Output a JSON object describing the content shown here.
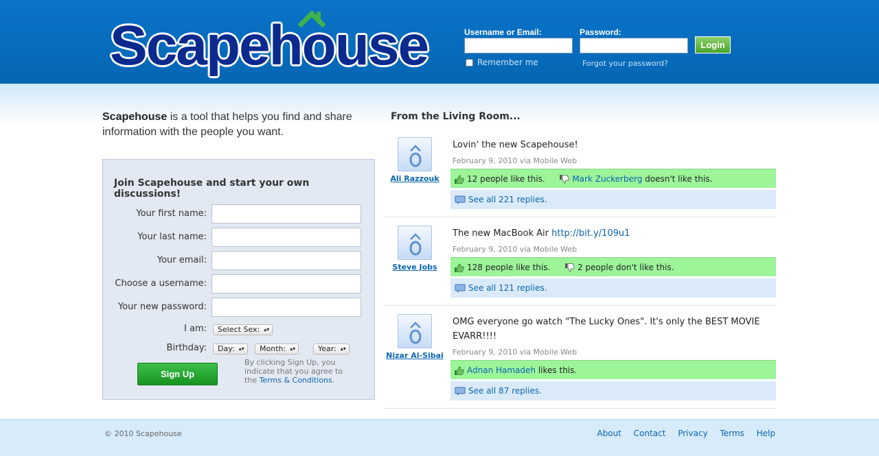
{
  "header": {
    "logo_text": "Scapehouse",
    "login": {
      "username_label": "Username or Email:",
      "password_label": "Password:",
      "login_button": "Login",
      "remember_label": "Remember me",
      "forgot_link": "Forgot your password?"
    }
  },
  "intro": {
    "brand": "Scapehouse",
    "text": " is a tool that helps you find and share information with the people you want."
  },
  "signup": {
    "title": "Join Scapehouse and start your own discussions!",
    "fields": {
      "first_name": "Your first name:",
      "last_name": "Your last name:",
      "email": "Your email:",
      "username": "Choose a username:",
      "password": "Your new password:",
      "iam": "I am:",
      "birthday": "Birthday:"
    },
    "sex_select": "Select Sex:",
    "day_select": "Day:",
    "month_select": "Month:",
    "year_select": "Year:",
    "signup_button": "Sign Up",
    "terms_text": "By clicking Sign Up, you indicate that you agree to the ",
    "terms_link": "Terms & Conditions",
    "terms_end": "."
  },
  "feed": {
    "title": "From the Living Room...",
    "posts": [
      {
        "author": "Ali Razzouk",
        "text": "Lovin' the new Scapehouse!",
        "meta": "February 9, 2010 via Mobile Web",
        "likes_text": "12 people like this.",
        "dislike_user": "Mark Zuckerberg",
        "dislike_text": " doesn't like this.",
        "replies": "See all 221 replies."
      },
      {
        "author": "Steve Jobs",
        "text": "The new MacBook Air ",
        "link": "http://bit.y/109u1",
        "meta": "February 9, 2010 via Mobile Web",
        "likes_text": "128 people like this.",
        "dislike_text": "2 people don't like this.",
        "replies": "See all 121 replies."
      },
      {
        "author": "Nizar Al-Sibai",
        "text": "OMG everyone go watch \"The Lucky Ones\". It's only the BEST MOVIE EVARR!!!!",
        "meta": "February 9, 2010 via Mobile Web",
        "like_user": "Adnan Hamadeh",
        "like_text": " likes this.",
        "replies": "See all 87 replies."
      }
    ]
  },
  "footer": {
    "copyright": "© 2010 Scapehouse",
    "links": [
      "About",
      "Contact",
      "Privacy",
      "Terms",
      "Help"
    ]
  },
  "colors": {
    "header_blue": "#0a6ebd",
    "logo_navy": "#0b2a8e",
    "link_blue": "#0a64b0",
    "like_green": "#9df59a",
    "signup_green": "#17931f"
  }
}
